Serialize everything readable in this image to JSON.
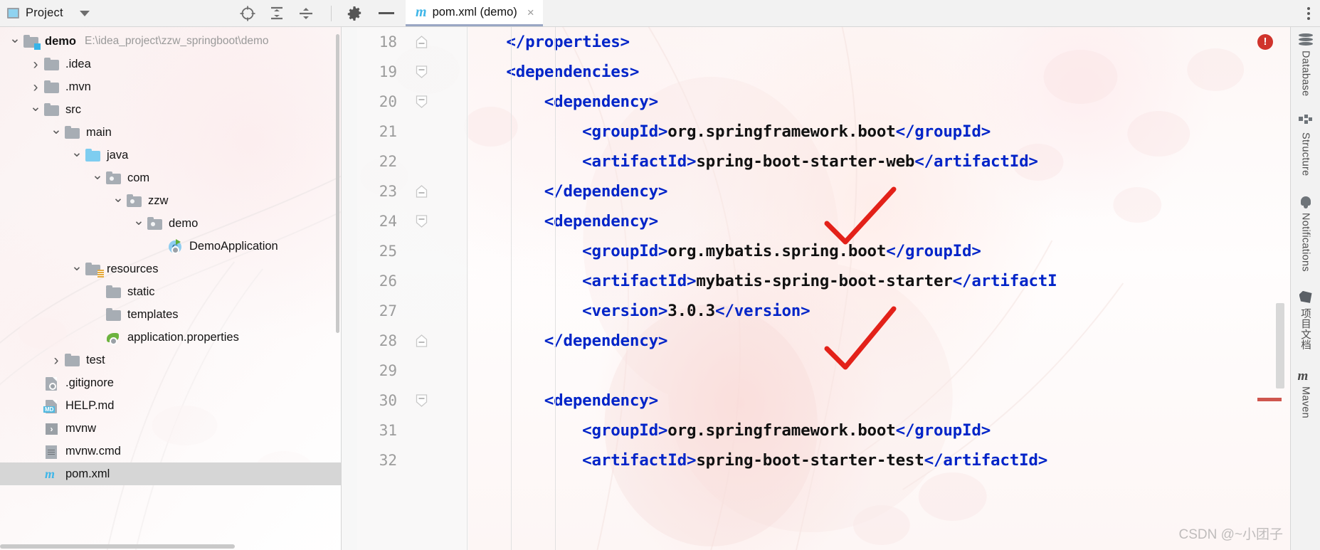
{
  "window": {
    "project_tool_title": "Project",
    "watermark": "CSDN @~小团子"
  },
  "project_toolbar": {
    "icons": [
      {
        "name": "select-opened-file-icon",
        "glyph": "target"
      },
      {
        "name": "expand-all-icon",
        "glyph": "expand"
      },
      {
        "name": "collapse-all-icon",
        "glyph": "collapse"
      }
    ],
    "settings_label": "Settings",
    "hide_label": "Hide"
  },
  "tabs": [
    {
      "label": "pom.xml (demo)",
      "icon": "maven-file-icon",
      "active": true,
      "close_label": "×"
    }
  ],
  "tree": [
    {
      "depth": 0,
      "arrow": "open",
      "icon": "module-folder-icon",
      "label": "demo",
      "bold": true,
      "path": "E:\\idea_project\\zzw_springboot\\demo"
    },
    {
      "depth": 1,
      "arrow": "closed",
      "icon": "folder-icon",
      "label": ".idea"
    },
    {
      "depth": 1,
      "arrow": "closed",
      "icon": "folder-icon",
      "label": ".mvn"
    },
    {
      "depth": 1,
      "arrow": "open",
      "icon": "folder-icon",
      "label": "src"
    },
    {
      "depth": 2,
      "arrow": "open",
      "icon": "folder-icon",
      "label": "main"
    },
    {
      "depth": 3,
      "arrow": "open",
      "icon": "source-folder-icon",
      "label": "java"
    },
    {
      "depth": 4,
      "arrow": "open",
      "icon": "package-icon",
      "label": "com"
    },
    {
      "depth": 5,
      "arrow": "open",
      "icon": "package-icon",
      "label": "zzw"
    },
    {
      "depth": 6,
      "arrow": "open",
      "icon": "package-icon",
      "label": "demo"
    },
    {
      "depth": 7,
      "arrow": "none",
      "icon": "java-class-run-icon",
      "label": "DemoApplication"
    },
    {
      "depth": 3,
      "arrow": "open",
      "icon": "resources-folder-icon",
      "label": "resources"
    },
    {
      "depth": 4,
      "arrow": "none",
      "icon": "folder-icon",
      "label": "static"
    },
    {
      "depth": 4,
      "arrow": "none",
      "icon": "folder-icon",
      "label": "templates"
    },
    {
      "depth": 4,
      "arrow": "none",
      "icon": "spring-properties-icon",
      "label": "application.properties"
    },
    {
      "depth": 2,
      "arrow": "closed",
      "icon": "folder-icon",
      "label": "test"
    },
    {
      "depth": 1,
      "arrow": "none",
      "icon": "gitignore-file-icon",
      "label": ".gitignore"
    },
    {
      "depth": 1,
      "arrow": "none",
      "icon": "markdown-file-icon",
      "label": "HELP.md"
    },
    {
      "depth": 1,
      "arrow": "none",
      "icon": "shell-script-icon",
      "label": "mvnw"
    },
    {
      "depth": 1,
      "arrow": "none",
      "icon": "cmd-file-icon",
      "label": "mvnw.cmd"
    },
    {
      "depth": 1,
      "arrow": "none",
      "icon": "maven-file-icon",
      "label": "pom.xml",
      "selected": true
    }
  ],
  "editor": {
    "first_line": 18,
    "lines": [
      {
        "num": 18,
        "fold": "end",
        "indent": 1,
        "tokens": [
          [
            "tag",
            "</properties>"
          ]
        ]
      },
      {
        "num": 19,
        "fold": "start",
        "indent": 1,
        "tokens": [
          [
            "tag",
            "<dependencies>"
          ]
        ]
      },
      {
        "num": 20,
        "fold": "start",
        "indent": 2,
        "tokens": [
          [
            "tag",
            "<dependency>"
          ]
        ]
      },
      {
        "num": 21,
        "fold": "",
        "indent": 3,
        "tokens": [
          [
            "tag",
            "<groupId>"
          ],
          [
            "txt",
            "org.springframework.boot"
          ],
          [
            "tag",
            "</groupId>"
          ]
        ]
      },
      {
        "num": 22,
        "fold": "",
        "indent": 3,
        "tokens": [
          [
            "tag",
            "<artifactId>"
          ],
          [
            "txt",
            "spring-boot-starter-web"
          ],
          [
            "tag",
            "</artifactId>"
          ]
        ]
      },
      {
        "num": 23,
        "fold": "end",
        "indent": 2,
        "tokens": [
          [
            "tag",
            "</dependency>"
          ]
        ]
      },
      {
        "num": 24,
        "fold": "start",
        "indent": 2,
        "tokens": [
          [
            "tag",
            "<dependency>"
          ]
        ]
      },
      {
        "num": 25,
        "fold": "",
        "indent": 3,
        "tokens": [
          [
            "tag",
            "<groupId>"
          ],
          [
            "txt",
            "org.mybatis.spring.boot"
          ],
          [
            "tag",
            "</groupId>"
          ]
        ]
      },
      {
        "num": 26,
        "fold": "",
        "indent": 3,
        "tokens": [
          [
            "tag",
            "<artifactId>"
          ],
          [
            "txt",
            "mybatis-spring-boot-starter"
          ],
          [
            "tag",
            "</artifactI"
          ]
        ]
      },
      {
        "num": 27,
        "fold": "",
        "indent": 3,
        "tokens": [
          [
            "tag",
            "<version>"
          ],
          [
            "txt",
            "3.0.3"
          ],
          [
            "tag",
            "</version>"
          ]
        ]
      },
      {
        "num": 28,
        "fold": "end",
        "indent": 2,
        "tokens": [
          [
            "tag",
            "</dependency>"
          ]
        ]
      },
      {
        "num": 29,
        "fold": "",
        "indent": 0,
        "tokens": []
      },
      {
        "num": 30,
        "fold": "start",
        "indent": 2,
        "tokens": [
          [
            "tag",
            "<dependency>"
          ]
        ]
      },
      {
        "num": 31,
        "fold": "",
        "indent": 3,
        "tokens": [
          [
            "tag",
            "<groupId>"
          ],
          [
            "txt",
            "org.springframework.boot"
          ],
          [
            "tag",
            "</groupId>"
          ]
        ]
      },
      {
        "num": 32,
        "fold": "",
        "indent": 3,
        "tokens": [
          [
            "tag",
            "<artifactId>"
          ],
          [
            "txt",
            "spring-boot-starter-test"
          ],
          [
            "tag",
            "</artifactId>"
          ]
        ]
      }
    ],
    "error_badge": "!",
    "annotations": [
      {
        "name": "red-check-mark-1",
        "shape": "check"
      },
      {
        "name": "red-check-mark-2",
        "shape": "check"
      }
    ]
  },
  "right_rail": [
    {
      "label": "Database",
      "icon": "database-icon"
    },
    {
      "label": "Structure",
      "icon": "structure-icon"
    },
    {
      "label": "Notifications",
      "icon": "bell-icon"
    },
    {
      "label": "项目文档",
      "icon": "project-doc-icon"
    },
    {
      "label": "Maven",
      "icon": "maven-icon"
    }
  ],
  "colors": {
    "tag": "#0024c8",
    "text": "#111111",
    "line_number": "#9c9c9c",
    "accent": "#38b4e8",
    "error": "#d0342c",
    "check_mark": "#e32119"
  }
}
